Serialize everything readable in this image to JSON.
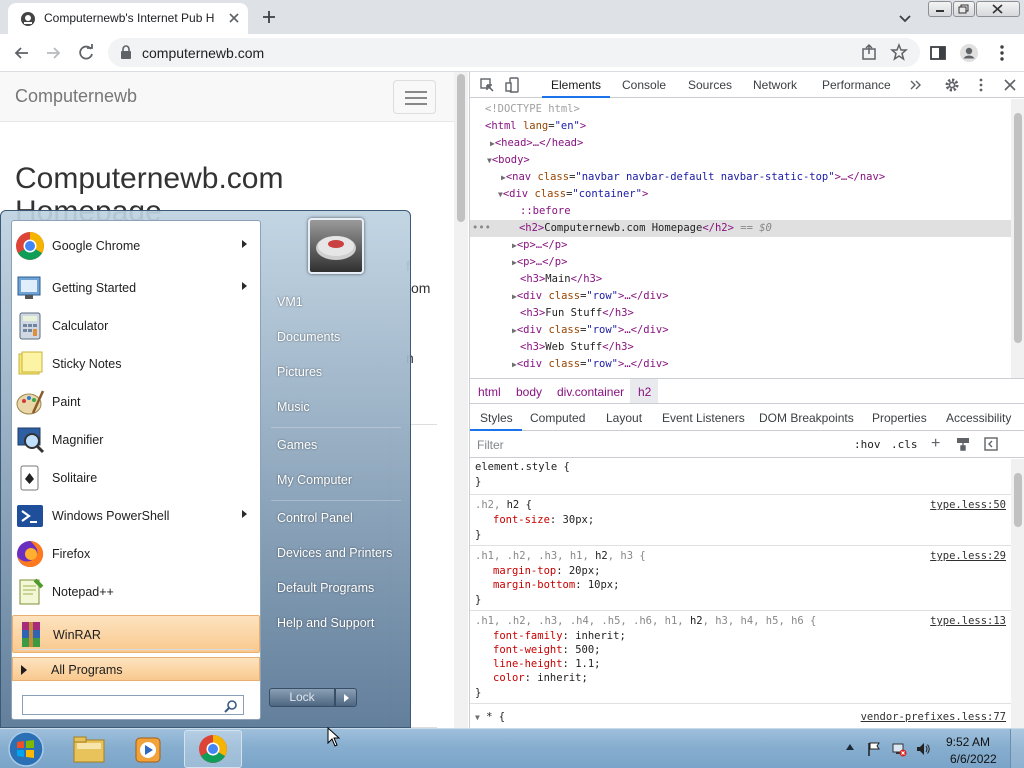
{
  "browser": {
    "tab_title": "Computernewb's Internet Pub H",
    "url": "computernewb.com"
  },
  "page": {
    "brand": "Computernewb",
    "heading_line1": "Computernewb.com",
    "heading_line2": "Homepage",
    "fragments": [
      "f",
      "om",
      "n"
    ]
  },
  "devtools": {
    "tabs": [
      "Elements",
      "Console",
      "Sources",
      "Network",
      "Performance"
    ],
    "dom": {
      "doctype": "<!DOCTYPE html>",
      "html_open_tag": "<html",
      "html_attr": "lang",
      "html_attr_val": "\"en\"",
      "html_open_close": ">",
      "head": "<head>…</head>",
      "body_open": "<body>",
      "nav_tag": "<nav",
      "nav_attr": "class",
      "nav_val": "\"navbar navbar-default navbar-static-top\"",
      "nav_rest": ">…</nav>",
      "div_tag": "<div",
      "div_attr": "class",
      "div_val": "\"container\"",
      "div_close": ">",
      "before": "::before",
      "h2_open": "<h2>",
      "h2_text": "Computernewb.com Homepage",
      "h2_close": "</h2>",
      "h2_eq": "== $0",
      "p1": "<p>…</p>",
      "p2": "<p>…</p>",
      "h3_main_open": "<h3>",
      "h3_main_text": "Main",
      "h3_main_close": "</h3>",
      "row_tag": "<div",
      "row_attr": "class",
      "row_val": "\"row\"",
      "row_rest": ">…</div>",
      "h3_fun_text": "Fun Stuff",
      "h3_web_text": "Web Stuff"
    },
    "breadcrumbs": [
      "html",
      "body",
      "div.container",
      "h2"
    ],
    "sub_tabs": [
      "Styles",
      "Computed",
      "Layout",
      "Event Listeners",
      "DOM Breakpoints",
      "Properties",
      "Accessibility"
    ],
    "filter_placeholder": "Filter",
    "hov": ":hov",
    "cls": ".cls",
    "rules": {
      "r0_sel": "element.style {",
      "r1_sel_dim": ".h2, ",
      "r1_sel": "h2 {",
      "r1_src": "type.less:50",
      "r1_p1_name": "font-size",
      "r1_p1_val": ": 30px;",
      "r2_sel_dim": ".h1, .h2, .h3, h1, ",
      "r2_sel": "h2",
      "r2_sel_tail": ", h3 {",
      "r2_src": "type.less:29",
      "r2_p1_name": "margin-top",
      "r2_p1_val": ": 20px;",
      "r2_p2_name": "margin-bottom",
      "r2_p2_val": ": 10px;",
      "r3_sel_dim": ".h1, .h2, .h3, .h4, .h5, .h6, h1, ",
      "r3_sel": "h2",
      "r3_sel_tail": ", h3, h4, h5, h6 {",
      "r3_src": "type.less:13",
      "r3_p1_name": "font-family",
      "r3_p1_val": ": inherit;",
      "r3_p2_name": "font-weight",
      "r3_p2_val": ": 500;",
      "r3_p3_name": "line-height",
      "r3_p3_val": ": 1.1;",
      "r3_p4_name": "color",
      "r3_p4_val": ": inherit;",
      "r4_sel": "* {",
      "r4_src": "vendor-prefixes.less:77",
      "close": "}"
    }
  },
  "start_menu": {
    "programs": [
      {
        "label": "Google Chrome",
        "icon": "chrome-icon",
        "has_submenu": true
      },
      {
        "label": "Getting Started",
        "icon": "getting-started-icon",
        "has_submenu": true
      },
      {
        "label": "Calculator",
        "icon": "calculator-icon",
        "has_submenu": false
      },
      {
        "label": "Sticky Notes",
        "icon": "sticky-notes-icon",
        "has_submenu": false
      },
      {
        "label": "Paint",
        "icon": "paint-icon",
        "has_submenu": false
      },
      {
        "label": "Magnifier",
        "icon": "magnifier-icon",
        "has_submenu": false
      },
      {
        "label": "Solitaire",
        "icon": "solitaire-icon",
        "has_submenu": false
      },
      {
        "label": "Windows PowerShell",
        "icon": "powershell-icon",
        "has_submenu": true
      },
      {
        "label": "Firefox",
        "icon": "firefox-icon",
        "has_submenu": false
      },
      {
        "label": "Notepad++",
        "icon": "notepad-plus-plus-icon",
        "has_submenu": false
      },
      {
        "label": "WinRAR",
        "icon": "winrar-icon",
        "has_submenu": false
      }
    ],
    "all_programs": "All Programs",
    "right_links": [
      "VM1",
      "Documents",
      "Pictures",
      "Music",
      "Games",
      "My Computer",
      "Control Panel",
      "Devices and Printers",
      "Default Programs",
      "Help and Support"
    ],
    "lock_label": "Lock"
  },
  "taskbar": {
    "time": "9:52 AM",
    "date": "6/6/2022"
  },
  "colors": {
    "devtools_accent": "#1a73e8",
    "tag_color": "#881280",
    "attr_color": "#994500",
    "value_color": "#1a1aa6",
    "prop_color": "#c80000",
    "winrar_highlight": "#f9c98e"
  }
}
